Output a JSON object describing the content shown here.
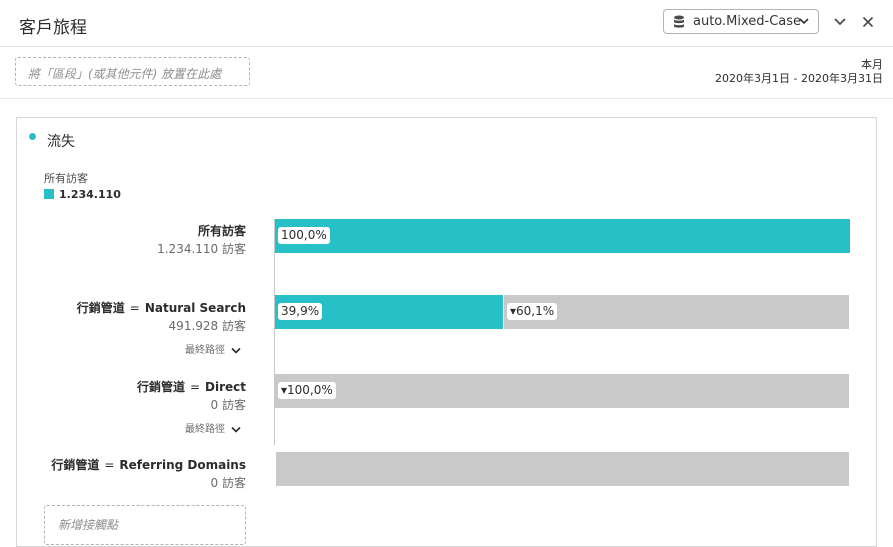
{
  "header": {
    "title": "客戶旅程",
    "data_source": "auto.Mixed-Case"
  },
  "toolbar": {
    "segment_placeholder": "將「區段」(或其他元件) 放置在此處",
    "date_preset": "本月",
    "date_range": "2020年3月1日 - 2020年3月31日"
  },
  "panel": {
    "title": "流失",
    "legend": {
      "label": "所有訪客",
      "value": "1.234.110",
      "color": "#27c0c6"
    },
    "rows": [
      {
        "title": "所有訪客",
        "count": "1.234.110 訪客",
        "bars": [
          {
            "label": "100,0%",
            "fraction": 1.0,
            "color": "teal"
          }
        ]
      },
      {
        "field": "行銷管道",
        "operator": "=",
        "value": "Natural Search",
        "count": "491.928 訪客",
        "path_label": "最終路徑",
        "bars": [
          {
            "label": "39,9%",
            "fraction": 0.399,
            "color": "teal"
          },
          {
            "label": "▾60,1%",
            "fraction": 0.601,
            "color": "gray"
          }
        ]
      },
      {
        "field": "行銷管道",
        "operator": "=",
        "value": "Direct",
        "count": "0 訪客",
        "path_label": "最終路徑",
        "bars": [
          {
            "label": "▾100,0%",
            "fraction": 1.0,
            "color": "gray"
          }
        ]
      },
      {
        "field": "行銷管道",
        "operator": "=",
        "value": "Referring Domains",
        "count": "0 訪客",
        "bars": [
          {
            "label": "",
            "fraction": 1.0,
            "color": "gray"
          }
        ]
      }
    ],
    "add_touchpoint": "新增接觸點"
  },
  "colors": {
    "accent": "#27c0c6",
    "fallout": "#c9c9c9"
  }
}
